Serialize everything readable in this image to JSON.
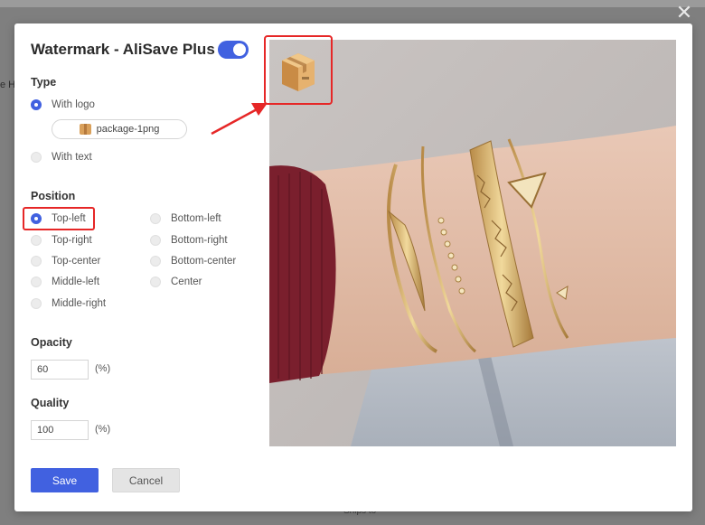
{
  "background": {
    "edge_text": "e H",
    "footer_text": "Ships to"
  },
  "dialog": {
    "title": "Watermark - AliSave Plus",
    "enabled": true,
    "close_icon": "close-icon",
    "type": {
      "label": "Type",
      "options": [
        {
          "label": "With logo",
          "checked": true
        },
        {
          "label": "With text",
          "checked": false
        }
      ],
      "file_name": "package-1png",
      "file_icon": "package-icon"
    },
    "position": {
      "label": "Position",
      "left_column": [
        {
          "label": "Top-left",
          "checked": true
        },
        {
          "label": "Top-right",
          "checked": false
        },
        {
          "label": "Top-center",
          "checked": false
        },
        {
          "label": "Middle-left",
          "checked": false
        },
        {
          "label": "Middle-right",
          "checked": false
        }
      ],
      "right_column": [
        {
          "label": "Bottom-left",
          "checked": false
        },
        {
          "label": "Bottom-right",
          "checked": false
        },
        {
          "label": "Bottom-center",
          "checked": false
        },
        {
          "label": "Center",
          "checked": false
        }
      ]
    },
    "opacity": {
      "label": "Opacity",
      "value": "60",
      "unit": "(%)"
    },
    "quality": {
      "label": "Quality",
      "value": "100",
      "unit": "(%)"
    },
    "buttons": {
      "save": "Save",
      "cancel": "Cancel"
    },
    "colors": {
      "accent": "#4161e0",
      "highlight": "#e62727"
    }
  }
}
